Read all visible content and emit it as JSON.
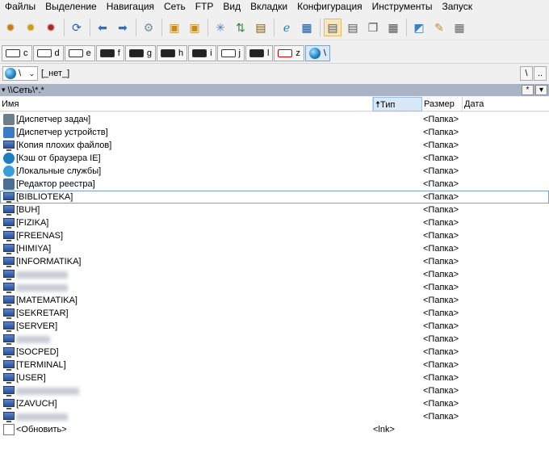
{
  "menu": [
    "Файлы",
    "Выделение",
    "Навигация",
    "Сеть",
    "FTP",
    "Вид",
    "Вкладки",
    "Конфигурация",
    "Инструменты",
    "Запуск"
  ],
  "toolbar_icons": [
    "gear-icon",
    "gear-icon",
    "gear-icon",
    "refresh-icon",
    "arrow-left-icon",
    "arrow-right-icon",
    "settings-icon",
    "pack-icon",
    "unpack-icon",
    "star-icon",
    "sort-icon",
    "clipboard-icon",
    "ie-icon",
    "monitor-icon",
    "notepad-icon",
    "notepad-icon",
    "copy-icon",
    "grid-icon",
    "book-icon",
    "brush-icon",
    "calculator-icon"
  ],
  "drives": [
    "c",
    "d",
    "e",
    "f",
    "g",
    "h",
    "i",
    "j",
    "l",
    "z",
    "\\"
  ],
  "drive_select": {
    "value": "\\",
    "volume_label": "[_нет_]"
  },
  "path_buttons": {
    "root": "\\",
    "up": ".."
  },
  "path": "\\\\Сеть\\*.*",
  "path_bar_buttons": {
    "filter": "*",
    "history": "▾"
  },
  "columns": {
    "name": "Имя",
    "type": "Тип",
    "size": "Размер",
    "date": "Дата"
  },
  "rows": [
    {
      "name": "[Диспетчер задач]",
      "size": "<Папка>",
      "icon": "task-manager-icon"
    },
    {
      "name": "[Диспетчер устройств]",
      "size": "<Папка>",
      "icon": "device-manager-icon"
    },
    {
      "name": "[Копия плохих файлов]",
      "size": "<Папка>",
      "icon": "computer-icon"
    },
    {
      "name": "[Кэш от браузера IE]",
      "size": "<Папка>",
      "icon": "ie-icon"
    },
    {
      "name": "[Локальные службы]",
      "size": "<Папка>",
      "icon": "services-icon"
    },
    {
      "name": "[Редактор реестра]",
      "size": "<Папка>",
      "icon": "registry-icon"
    },
    {
      "name": "[BIBLIOTEKA]",
      "size": "<Папка>",
      "icon": "computer-icon"
    },
    {
      "name": "[BUH]",
      "size": "<Папка>",
      "icon": "computer-icon"
    },
    {
      "name": "[FIZIKA]",
      "size": "<Папка>",
      "icon": "computer-icon"
    },
    {
      "name": "[FREENAS]",
      "size": "<Папка>",
      "icon": "computer-icon"
    },
    {
      "name": "[HIMIYA]",
      "size": "<Папка>",
      "icon": "computer-icon"
    },
    {
      "name": "[INFORMATIKA]",
      "size": "<Папка>",
      "icon": "computer-icon"
    },
    {
      "name": "",
      "size": "<Папка>",
      "icon": "computer-icon",
      "blurred": true
    },
    {
      "name": "",
      "size": "<Папка>",
      "icon": "computer-icon",
      "blurred": true
    },
    {
      "name": "[MATEMATIKA]",
      "size": "<Папка>",
      "icon": "computer-icon"
    },
    {
      "name": "[SEKRETAR]",
      "size": "<Папка>",
      "icon": "computer-icon"
    },
    {
      "name": "[SERVER]",
      "size": "<Папка>",
      "icon": "computer-icon"
    },
    {
      "name": "",
      "size": "<Папка>",
      "icon": "computer-icon",
      "blurred": true
    },
    {
      "name": "[SOCPED]",
      "size": "<Папка>",
      "icon": "computer-icon"
    },
    {
      "name": "[TERMINAL]",
      "size": "<Папка>",
      "icon": "computer-icon"
    },
    {
      "name": "[USER]",
      "size": "<Папка>",
      "icon": "computer-icon"
    },
    {
      "name": "",
      "size": "<Папка>",
      "icon": "computer-icon",
      "blurred": true
    },
    {
      "name": "[ZAVUCH]",
      "size": "<Папка>",
      "icon": "computer-icon"
    },
    {
      "name": "",
      "size": "<Папка>",
      "icon": "computer-icon",
      "blurred": true
    }
  ],
  "refresh_row": {
    "name": "<Обновить>",
    "type": "<lnk>"
  }
}
